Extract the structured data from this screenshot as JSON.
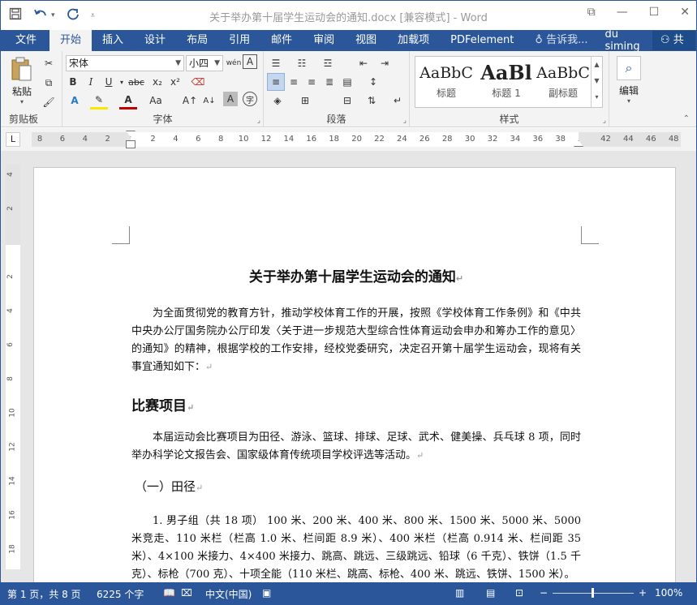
{
  "window": {
    "title": "关于举办第十届学生运动会的通知.docx [兼容模式] - Word"
  },
  "qat": {
    "save_icon": "save-icon",
    "undo_icon": "undo-icon",
    "redo_icon": "redo-icon",
    "customize_icon": "customize-icon"
  },
  "tabs": [
    {
      "label": "文件"
    },
    {
      "label": "开始"
    },
    {
      "label": "插入"
    },
    {
      "label": "设计"
    },
    {
      "label": "布局"
    },
    {
      "label": "引用"
    },
    {
      "label": "邮件"
    },
    {
      "label": "审阅"
    },
    {
      "label": "视图"
    },
    {
      "label": "加载项"
    },
    {
      "label": "PDFelement"
    }
  ],
  "tell_me": "告诉我...",
  "user": "du siming",
  "share": "共享",
  "ribbon": {
    "clipboard": {
      "paste": "粘贴",
      "label": "剪贴板"
    },
    "font": {
      "name": "宋体",
      "size": "小四",
      "label": "字体"
    },
    "paragraph": {
      "label": "段落"
    },
    "styles": {
      "label": "样式",
      "items": [
        {
          "preview": "AaBbC",
          "name": "标题"
        },
        {
          "preview": "AaBl",
          "name": "标题 1"
        },
        {
          "preview": "AaBbC",
          "name": "副标题"
        }
      ]
    },
    "editing": {
      "label": "编辑"
    }
  },
  "ruler": {
    "h_numbers": [
      "8",
      "6",
      "4",
      "2",
      "",
      "2",
      "4",
      "6",
      "8",
      "10",
      "12",
      "14",
      "16",
      "18",
      "20",
      "22",
      "24",
      "26",
      "28",
      "30",
      "32",
      "34",
      "36",
      "38",
      "",
      "42",
      "44",
      "46",
      "48"
    ],
    "v_numbers": [
      "4",
      "2",
      "",
      "2",
      "4",
      "6",
      "8",
      "10",
      "12",
      "14",
      "16",
      "18"
    ]
  },
  "document": {
    "title": "关于举办第十届学生运动会的通知",
    "para1": "为全面贯彻党的教育方针，推动学校体育工作的开展，按照《学校体育工作条例》和《中共中央办公厅国务院办公厅印发〈关于进一步规范大型综合性体育运动会申办和筹办工作的意见〉的通知》的精神，根据学校的工作安排，经校党委研究，决定召开第十届学生运动会，现将有关事宜通知如下：",
    "heading1": "比赛项目",
    "para2": "本届运动会比赛项目为田径、游泳、篮球、排球、足球、武术、健美操、兵乓球 8 项，同时举办科学论文报告会、国家级体育传统项目学校评选等活动。",
    "heading2": "（一）田径",
    "para3": "1. 男子组（共 18 项） 100 米、200 米、400 米、800 米、1500 米、5000 米、5000 米竞走、110 米栏（栏高 1.0 米、栏间距 8.9 米）、400 米栏（栏高 0.914 米、栏间距 35 米）、4×100 米接力、4×400 米接力、跳高、跳远、三级跳远、铅球（6 千克）、铁饼（1.5 千克）、标枪（700 克）、十项全能（110 米栏、跳高、标枪、400 米、跳远、铁饼、1500 米）。",
    "pilcrow": "↵"
  },
  "status": {
    "page": "第 1 页，共 8 页",
    "words": "6225 个字",
    "language": "中文(中国)",
    "zoom": "100%",
    "zoom_level_pct": 100
  }
}
